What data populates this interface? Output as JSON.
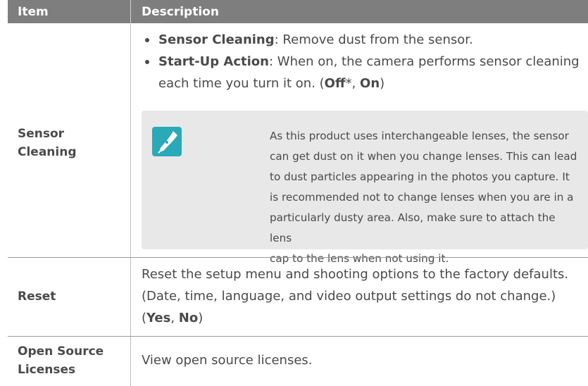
{
  "header": {
    "item": "Item",
    "description": "Description"
  },
  "rows": [
    {
      "label_lines": [
        "Sensor",
        "Cleaning"
      ],
      "bullets": [
        {
          "term": "Sensor Cleaning",
          "text": ": Remove dust from the sensor."
        },
        {
          "term": "Start-Up Action",
          "text": ": When on, the camera performs sensor cleaning each time you turn it on. (",
          "opt1": "Off",
          "mid": "*, ",
          "opt2": "On",
          "end": ")"
        }
      ],
      "note": {
        "icon": "pen-note-icon",
        "icon_color": "#2aa9b8",
        "lines": [
          "As this product uses interchangeable lenses, the sensor",
          "can get dust on it when you change lenses. This can lead",
          "to dust particles appearing in the photos you capture. It",
          "is recommended not to change lenses when you are in a",
          "particularly dusty area. Also, make sure to attach the lens",
          "cap to the lens when not using it."
        ]
      }
    },
    {
      "label": "Reset",
      "text": "Reset the setup menu and shooting options to the factory defaults. (Date, time, language, and video output settings do not change.) (",
      "opt1": "Yes",
      "sep": ", ",
      "opt2": "No",
      "end": ")"
    },
    {
      "label_lines": [
        "Open Source",
        "Licenses"
      ],
      "text": "View open source licenses."
    }
  ],
  "colors": {
    "header_bg": "#7e7e7e",
    "note_bg": "#e8e8e8",
    "accent": "#2aa9b8"
  }
}
